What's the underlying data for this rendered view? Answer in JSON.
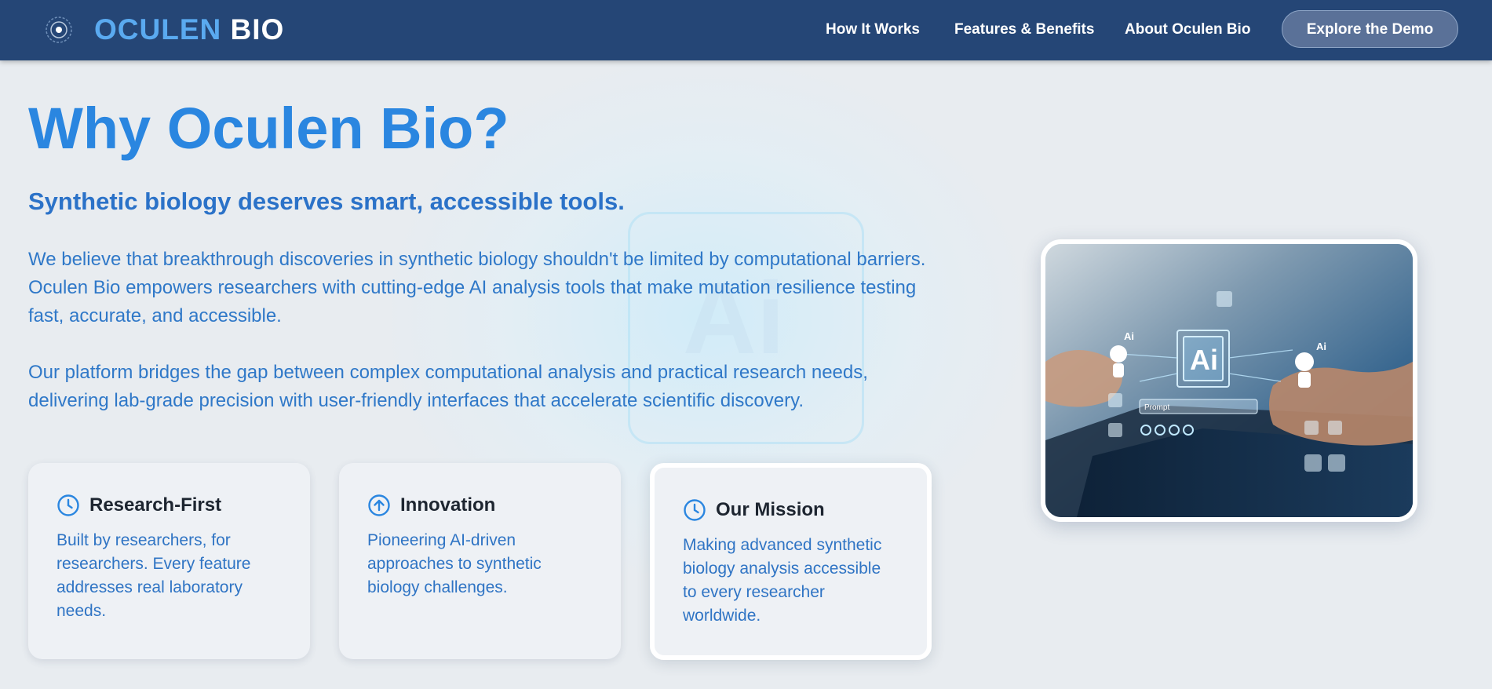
{
  "nav": {
    "brand_part1": "OCULEN",
    "brand_part2": "BIO",
    "links": [
      "How It Works",
      "Features & Benefits",
      "About Oculen Bio"
    ],
    "cta": "Explore the Demo"
  },
  "hero": {
    "title": "Why Oculen Bio?",
    "subtitle": "Synthetic biology deserves smart, accessible tools.",
    "paragraph1": "We believe that breakthrough discoveries in synthetic biology shouldn't be limited by computational barriers. Oculen Bio empowers researchers with cutting-edge AI analysis tools that make mutation resilience testing fast, accurate, and accessible.",
    "paragraph2": "Our platform bridges the gap between complex computational analysis and practical research needs, delivering lab-grade precision with user-friendly interfaces that accelerate scientific discovery."
  },
  "cards": [
    {
      "icon": "clock-icon",
      "title": "Research-First",
      "text": "Built by researchers, for researchers. Every feature addresses real laboratory needs."
    },
    {
      "icon": "arrow-up-circle-icon",
      "title": "Innovation",
      "text": "Pioneering AI-driven approaches to synthetic biology challenges."
    },
    {
      "icon": "clock-icon",
      "title": "Our Mission",
      "text": "Making advanced synthetic biology analysis accessible to every researcher worldwide."
    }
  ],
  "image": {
    "ai_label": "Ai",
    "prompt_label": "Prompt"
  },
  "colors": {
    "nav_bg": "#254676",
    "accent": "#2a86e0",
    "brand_light": "#5aaaf0",
    "text_blue": "#2f78c8"
  }
}
